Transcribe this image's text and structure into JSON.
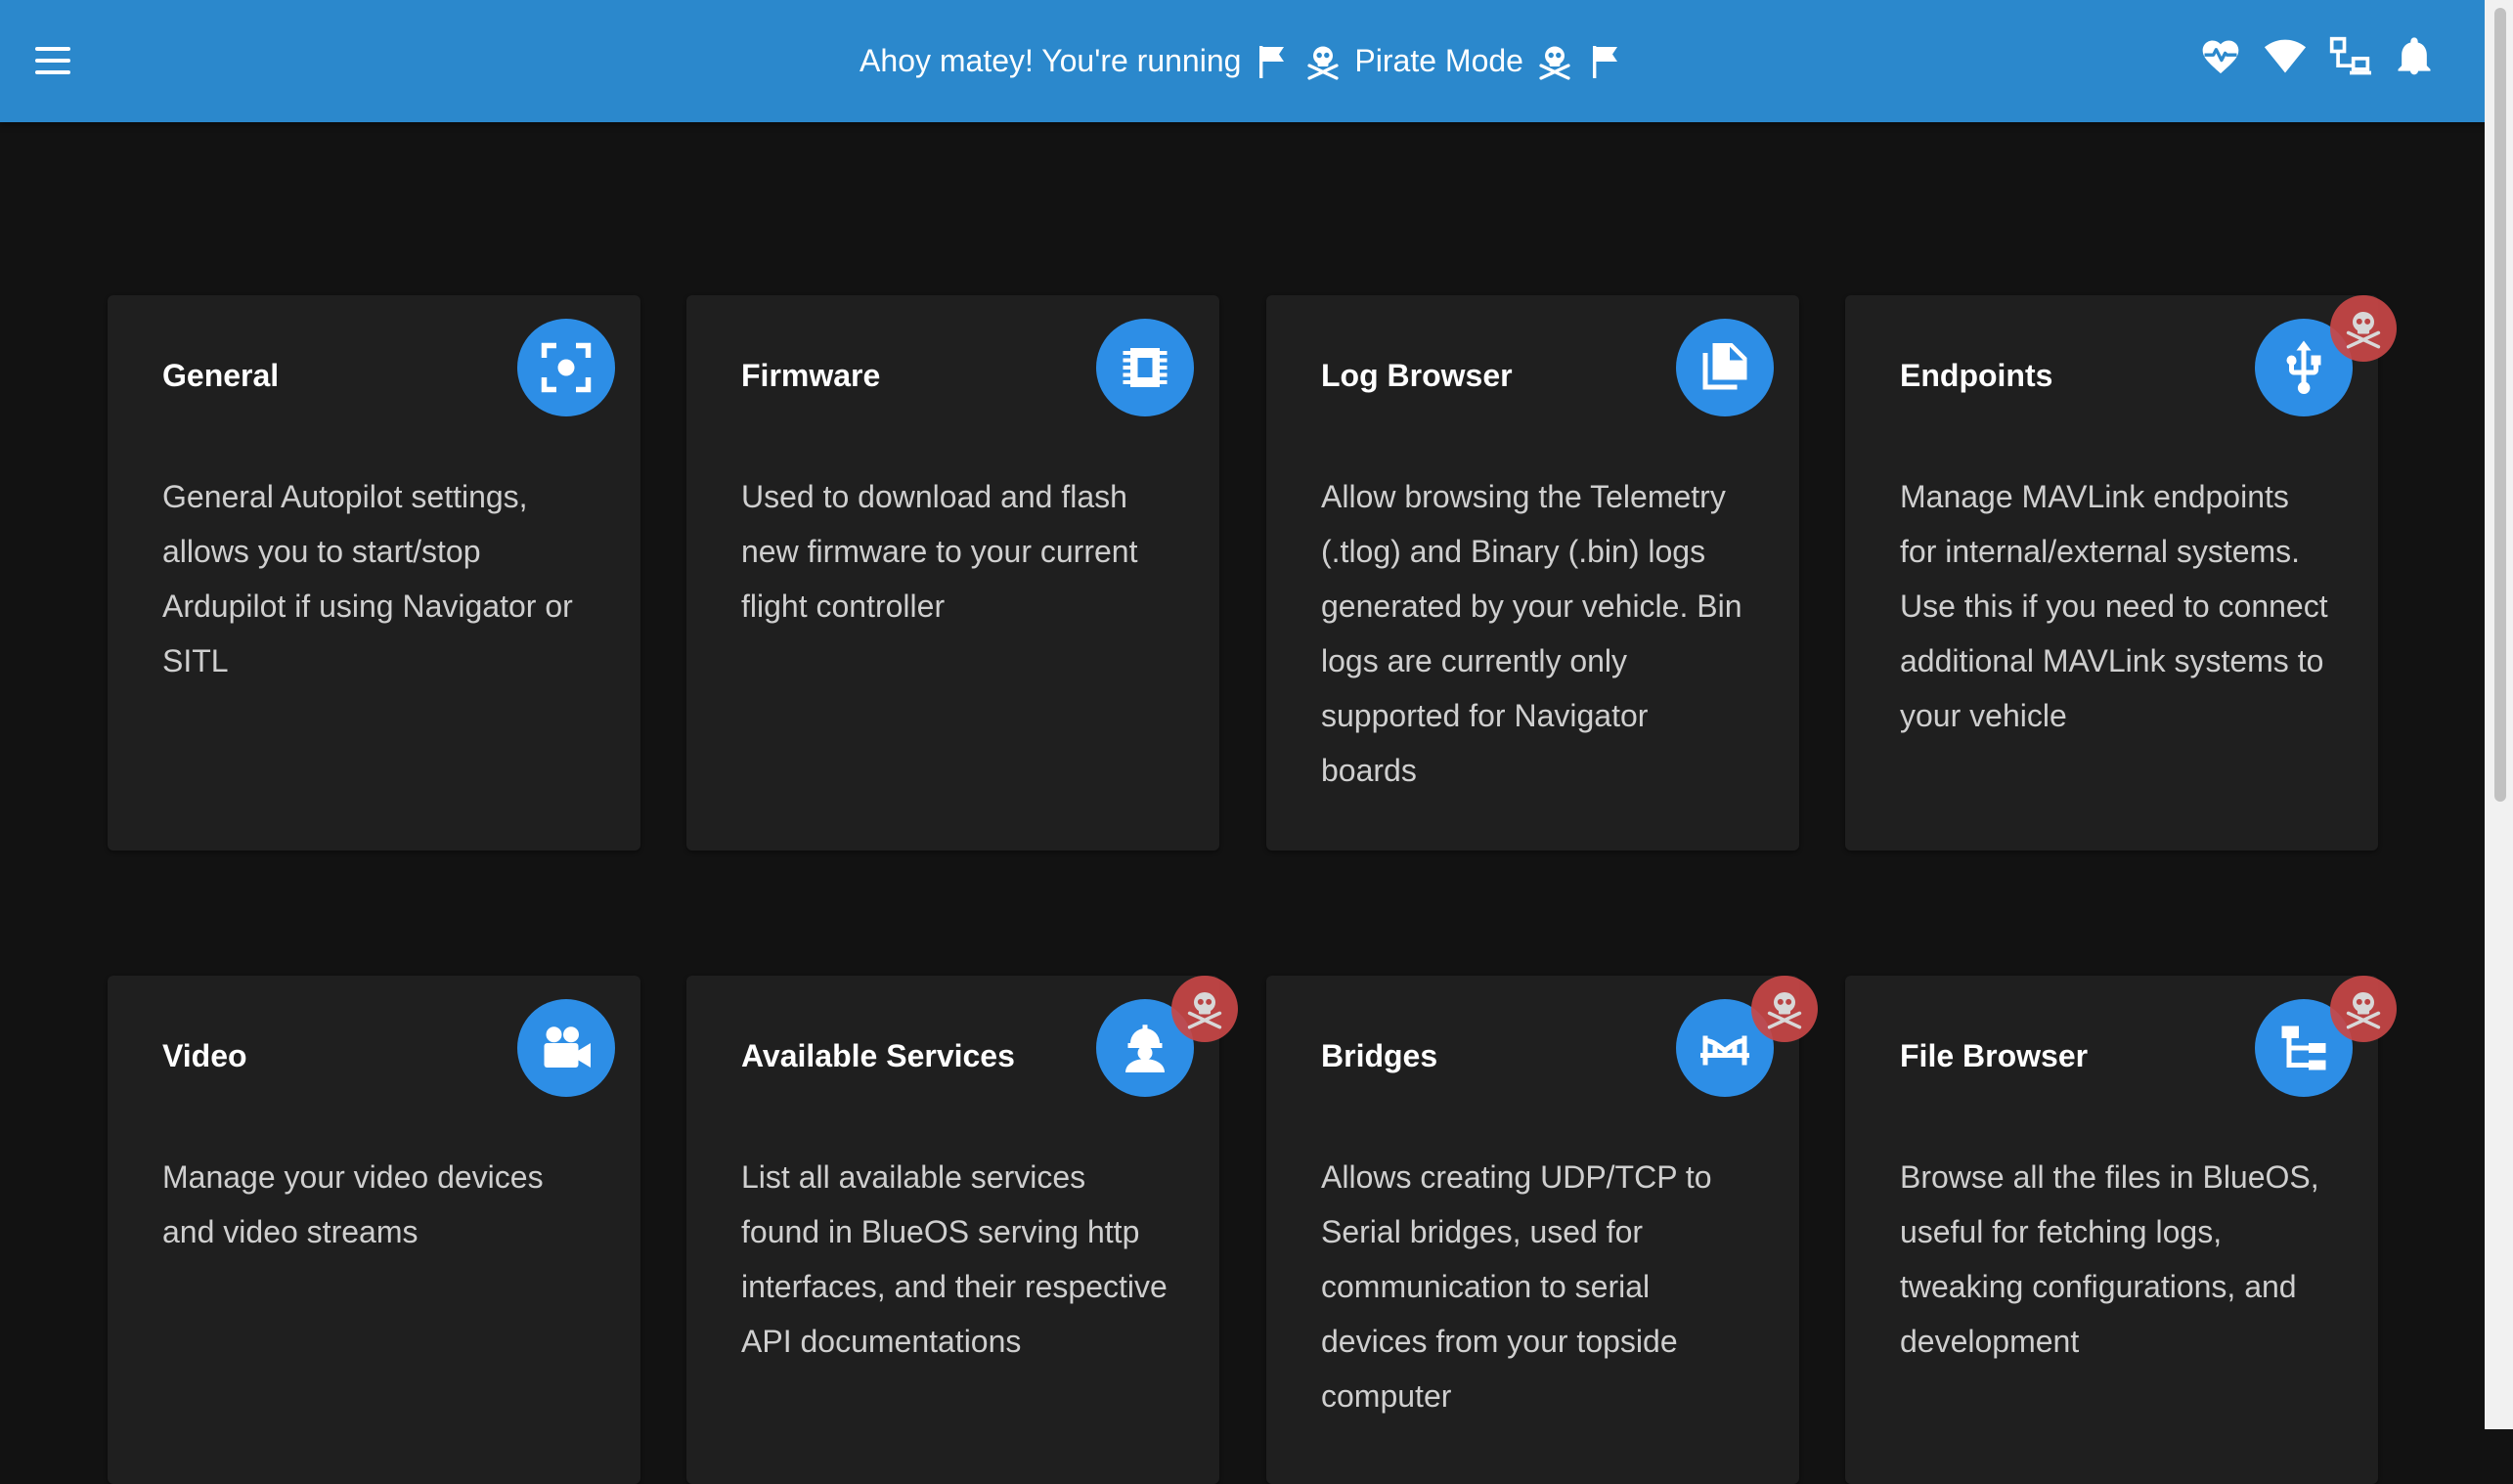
{
  "header": {
    "banner_prefix": "Ahoy matey! You're running",
    "banner_mode": "Pirate Mode",
    "accent_color": "#2b88cc",
    "status_icons": [
      "heart-pulse-icon",
      "wifi-icon",
      "lan-icon",
      "bell-icon"
    ]
  },
  "cards": [
    {
      "title": "General",
      "description": "General Autopilot settings, allows you to start/stop Ardupilot if using Navigator or SITL",
      "icon": "focus-icon",
      "pirate": false
    },
    {
      "title": "Firmware",
      "description": "Used to download and flash new firmware to your current flight controller",
      "icon": "chip-icon",
      "pirate": false
    },
    {
      "title": "Log Browser",
      "description": "Allow browsing the Telemetry (.tlog) and Binary (.bin) logs generated by your vehicle. Bin logs are currently only supported for Navigator boards",
      "icon": "file-multiple-icon",
      "pirate": false
    },
    {
      "title": "Endpoints",
      "description": "Manage MAVLink endpoints for internal/external systems. Use this if you need to connect additional MAVLink systems to your vehicle",
      "icon": "usb-icon",
      "pirate": true
    },
    {
      "title": "Video",
      "description": "Manage your video devices and video streams",
      "icon": "video-camera-icon",
      "pirate": false
    },
    {
      "title": "Available Services",
      "description": "List all available services found in BlueOS serving http interfaces, and their respective API documentations",
      "icon": "worker-icon",
      "pirate": true
    },
    {
      "title": "Bridges",
      "description": "Allows creating UDP/TCP to Serial bridges, used for communication to serial devices from your topside computer",
      "icon": "bridge-icon",
      "pirate": true
    },
    {
      "title": "File Browser",
      "description": "Browse all the files in BlueOS, useful for fetching logs, tweaking configurations, and development",
      "icon": "file-tree-icon",
      "pirate": true
    }
  ]
}
